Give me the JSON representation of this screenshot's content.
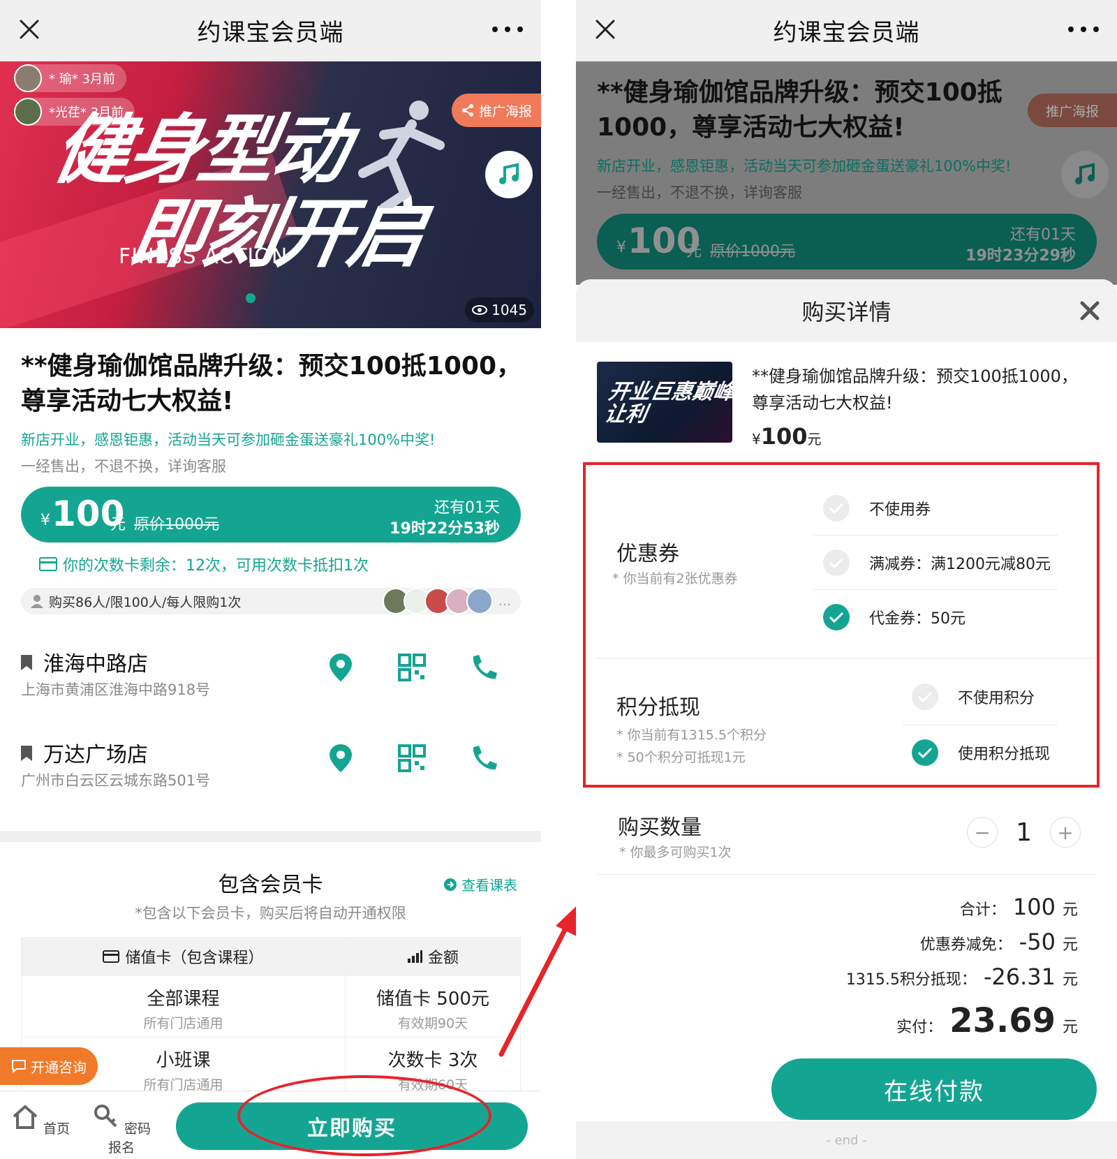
{
  "app_title": "约课宝会员端",
  "banner": {
    "line1": "健身型动",
    "line2": "即刻开启",
    "line3": "FINESS ACTION",
    "user1": "* 瑜* 3月前",
    "user2": "*光荏* 3月前",
    "promo_label": "推广海报",
    "views": "1045"
  },
  "product": {
    "title": "**健身瑜伽馆品牌升级：预交100抵1000，尊享活动七大权益!",
    "subtitle": "新店开业，感恩钜惠，活动当天可参加砸金蛋送豪礼100%中奖!",
    "note": "一经售出，不退不换，详询客服",
    "currency": "¥",
    "price": "100",
    "unit": "元",
    "original_price": "原价1000元",
    "countdown_days": "还有01天",
    "countdown_left": "19时22分53秒",
    "countdown_right": "19时23分29秒"
  },
  "card_balance": "你的次数卡剩余：12次，可用次数卡抵扣1次",
  "buyers": "购买86人/限100人/每人限购1次",
  "buyers_more": "...",
  "stores": [
    {
      "name": "淮海中路店",
      "address": "上海市黄浦区淮海中路918号"
    },
    {
      "name": "万达广场店",
      "address": "广州市白云区云城东路501号"
    }
  ],
  "membership": {
    "title": "包含会员卡",
    "schedule_link": "查看课表",
    "subtitle": "*包含以下会员卡，购买后将自动开通权限",
    "col1": "储值卡（包含课程）",
    "col2": "金额",
    "rows": [
      {
        "course": "全部课程",
        "scope": "所有门店通用",
        "card": "储值卡 500元",
        "validity": "有效期90天"
      },
      {
        "course": "小班课",
        "scope": "所有门店通用",
        "card": "次数卡 3次",
        "validity": "有效期60天"
      }
    ]
  },
  "consult_label": "开通咨询",
  "tabbar": {
    "home": "首页",
    "password": "密码报名",
    "buy": "立即购买"
  },
  "sheet": {
    "title": "购买详情",
    "product_name": "**健身瑜伽馆品牌升级：预交100抵1000，尊享活动七大权益!",
    "image_text": "开业巨惠巅峰让利",
    "price_currency": "¥",
    "price": "100",
    "price_unit": "元",
    "coupon": {
      "label": "优惠券",
      "hint": "* 你当前有2张优惠券",
      "options": [
        {
          "label": "不使用券",
          "checked": false
        },
        {
          "label": "满减券：满1200元减80元",
          "checked": false
        },
        {
          "label": "代金券：50元",
          "checked": true
        }
      ]
    },
    "points": {
      "label": "积分抵现",
      "hint1": "* 你当前有1315.5个积分",
      "hint2": "* 50个积分可抵现1元",
      "options": [
        {
          "label": "不使用积分",
          "checked": false
        },
        {
          "label": "使用积分抵现",
          "checked": true
        }
      ]
    },
    "quantity": {
      "label": "购买数量",
      "hint": "* 你最多可购买1次",
      "value": "1"
    },
    "summary": {
      "total_label": "合计：",
      "total": "100",
      "unit": "元",
      "coupon_label": "优惠券减免：",
      "coupon": "-50",
      "points_label": "1315.5积分抵现：",
      "points": "-26.31",
      "paid_label": "实付：",
      "paid": "23.69"
    },
    "pay_button": "在线付款",
    "end": "- end -"
  },
  "colors": {
    "accent": "#14a592",
    "orange": "#f07a2a",
    "annotation": "#e8232a"
  }
}
